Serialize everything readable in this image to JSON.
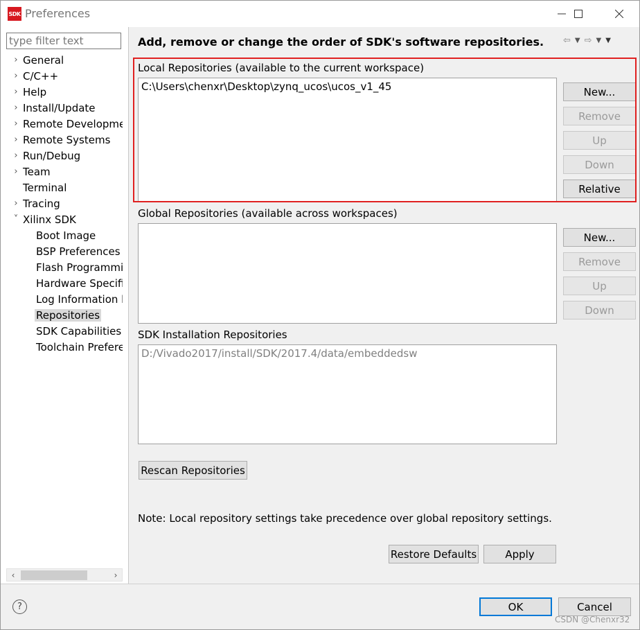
{
  "window": {
    "title": "Preferences",
    "icon_text": "SDK",
    "controls": [
      "minimize",
      "maximize",
      "close"
    ]
  },
  "filter": {
    "placeholder": "type filter text",
    "value": ""
  },
  "tree": [
    {
      "label": "General",
      "expandable": true,
      "level": 0
    },
    {
      "label": "C/C++",
      "expandable": true,
      "level": 0
    },
    {
      "label": "Help",
      "expandable": true,
      "level": 0
    },
    {
      "label": "Install/Update",
      "expandable": true,
      "level": 0
    },
    {
      "label": "Remote Developme",
      "expandable": true,
      "level": 0
    },
    {
      "label": "Remote Systems",
      "expandable": true,
      "level": 0
    },
    {
      "label": "Run/Debug",
      "expandable": true,
      "level": 0
    },
    {
      "label": "Team",
      "expandable": true,
      "level": 0
    },
    {
      "label": "Terminal",
      "expandable": false,
      "level": 0
    },
    {
      "label": "Tracing",
      "expandable": true,
      "level": 0
    },
    {
      "label": "Xilinx SDK",
      "expandable": true,
      "expanded": true,
      "level": 0
    },
    {
      "label": "Boot Image",
      "level": 1
    },
    {
      "label": "BSP Preferences",
      "level": 1
    },
    {
      "label": "Flash Programmin",
      "level": 1
    },
    {
      "label": "Hardware Specifi",
      "level": 1
    },
    {
      "label": "Log Information l",
      "level": 1
    },
    {
      "label": "Repositories",
      "level": 1,
      "selected": true
    },
    {
      "label": "SDK Capabilities",
      "level": 1
    },
    {
      "label": "Toolchain Prefere",
      "level": 1
    }
  ],
  "page": {
    "title": "Add, remove or change the order of SDK's software repositories.",
    "local": {
      "label": "Local Repositories (available to the current workspace)",
      "entries": [
        "C:\\Users\\chenxr\\Desktop\\zynq_ucos\\ucos_v1_45"
      ],
      "buttons": {
        "new": "New...",
        "remove": "Remove",
        "up": "Up",
        "down": "Down",
        "relative": "Relative"
      }
    },
    "global": {
      "label": "Global Repositories (available across workspaces)",
      "entries": [],
      "buttons": {
        "new": "New...",
        "remove": "Remove",
        "up": "Up",
        "down": "Down"
      }
    },
    "installation": {
      "label": "SDK Installation Repositories",
      "entries": [
        "D:/Vivado2017/install/SDK/2017.4/data/embeddedsw"
      ]
    },
    "rescan_button": "Rescan Repositories",
    "note": "Note: Local repository settings take precedence over global repository settings.",
    "restore_defaults": "Restore Defaults",
    "apply": "Apply"
  },
  "footer": {
    "help": "?",
    "ok": "OK",
    "cancel": "Cancel"
  },
  "watermark": "CSDN @Chenxr32",
  "colors": {
    "highlight": "#e02020",
    "selected_bg": "#d9d9d9",
    "default_button_border": "#0078d7"
  }
}
